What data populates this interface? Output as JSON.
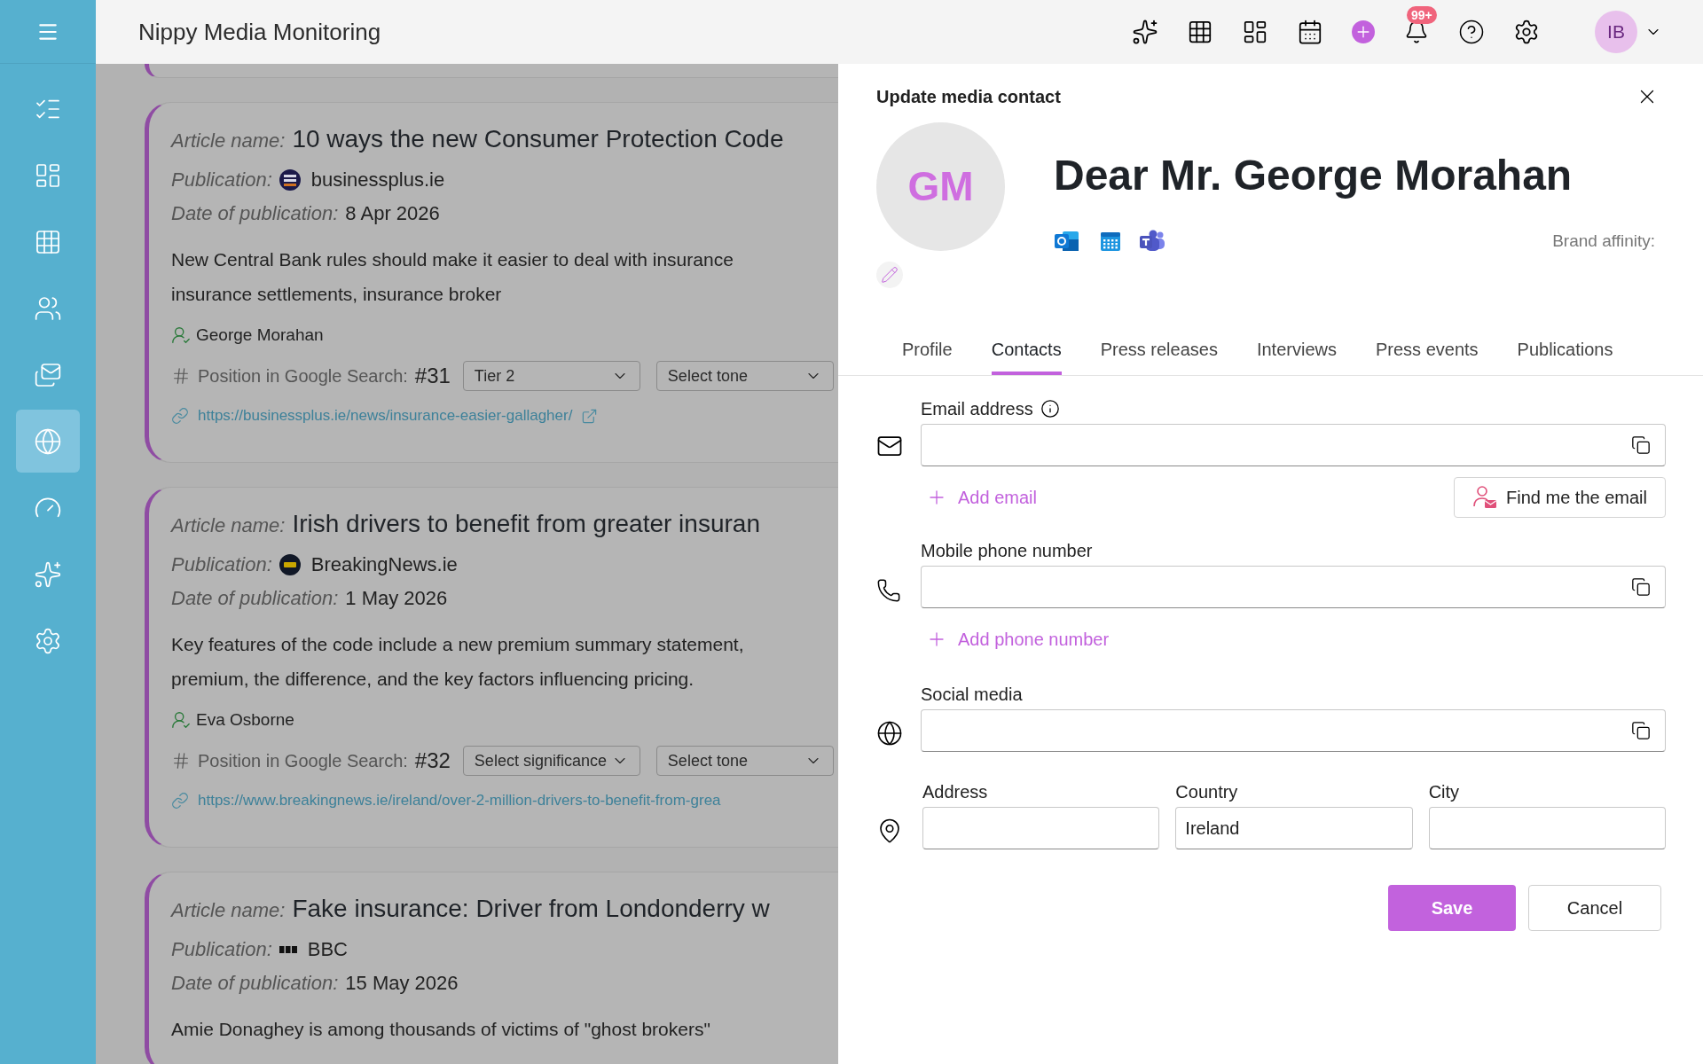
{
  "app": {
    "title": "Nippy Media Monitoring",
    "notifications_badge": "99+",
    "user_initials": "IB"
  },
  "sidebar": {
    "items": [
      {
        "selected": false
      },
      {
        "selected": false
      },
      {
        "selected": false
      },
      {
        "selected": false
      },
      {
        "selected": false
      },
      {
        "selected": true
      },
      {
        "selected": false
      },
      {
        "selected": false
      },
      {
        "selected": false
      }
    ]
  },
  "articles": [
    {
      "title_label": "Article name:",
      "title": "10 ways the new Consumer Protection Code",
      "publication_label": "Publication:",
      "publication_logo": {
        "kind": "badge"
      },
      "publication": "businessplus.ie",
      "date_label": "Date of publication:",
      "date": "8 Apr 2026",
      "description": [
        "New Central Bank rules should make it easier to deal with insurance",
        "insurance settlements, insurance broker"
      ],
      "author": "George Morahan",
      "position_label": "Position in Google Search:",
      "position": "#31",
      "significance": "Tier 2",
      "tone": "Select tone",
      "url": "https://businessplus.ie/news/insurance-easier-gallagher/",
      "external_link": true
    },
    {
      "title_label": "Article name:",
      "title": "Irish drivers to benefit from greater insuran",
      "publication_label": "Publication:",
      "publication_logo": {
        "kind": "disc"
      },
      "publication": "BreakingNews.ie",
      "date_label": "Date of publication:",
      "date": "1 May 2026",
      "description": [
        "Key features of the code include a new premium summary statement,",
        "premium, the difference, and the key factors influencing pricing."
      ],
      "author": "Eva Osborne",
      "position_label": "Position in Google Search:",
      "position": "#32",
      "significance": "Select significance",
      "tone": "Select tone",
      "url": "https://www.breakingnews.ie/ireland/over-2-million-drivers-to-benefit-from-grea",
      "external_link": false
    },
    {
      "title_label": "Article name:",
      "title": "Fake insurance: Driver from Londonderry w",
      "publication_label": "Publication:",
      "publication_logo": {
        "kind": "bars"
      },
      "publication": "BBC",
      "date_label": "Date of publication:",
      "date": "15 May 2026",
      "description": [
        "Amie Donaghey is among thousands of victims of \"ghost brokers\""
      ]
    }
  ],
  "drawer": {
    "title": "Update media contact",
    "avatar_initials": "GM",
    "name": "Dear Mr. George Morahan",
    "brand_affinity_label": "Brand affinity:",
    "tabs": [
      {
        "label": "Profile",
        "selected": false
      },
      {
        "label": "Contacts",
        "selected": true
      },
      {
        "label": "Press releases",
        "selected": false
      },
      {
        "label": "Interviews",
        "selected": false
      },
      {
        "label": "Press events",
        "selected": false
      },
      {
        "label": "Publications",
        "selected": false
      }
    ],
    "email": {
      "label": "Email address",
      "add_label": "Add email",
      "find_button": "Find me the email"
    },
    "phone": {
      "label": "Mobile phone number",
      "add_label": "Add phone number"
    },
    "social": {
      "label": "Social media"
    },
    "address_fields": [
      {
        "label": "Address"
      },
      {
        "label": "Country",
        "value": "Ireland"
      },
      {
        "label": "City"
      }
    ],
    "buttons": [
      {
        "label": "Save",
        "kind": "primary"
      },
      {
        "label": "Cancel",
        "kind": "secondary"
      }
    ]
  }
}
